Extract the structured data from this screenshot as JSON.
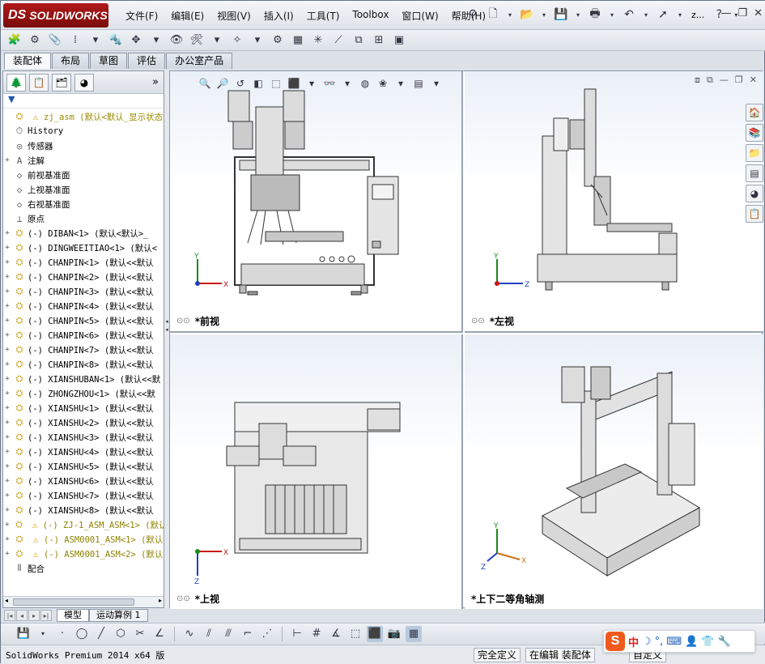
{
  "app": {
    "brand": "SOLIDWORKS",
    "brand_prefix": "DS"
  },
  "menu": [
    "文件(F)",
    "编辑(E)",
    "视图(V)",
    "插入(I)",
    "工具(T)",
    "Toolbox",
    "窗口(W)",
    "帮助(H)"
  ],
  "title_short": "z...",
  "help_label": "?",
  "cm_tabs": [
    "装配体",
    "布局",
    "草图",
    "评估",
    "办公室产品"
  ],
  "cm_active": 0,
  "fm_expand": "»",
  "filter_label": "▼",
  "tree": [
    {
      "label": "zj_asm  (默认<默认_显示状态",
      "icon": "asm",
      "warn": true,
      "expand": "",
      "style": "root"
    },
    {
      "label": "History",
      "icon": "history",
      "expand": ""
    },
    {
      "label": "传感器",
      "icon": "sensor",
      "expand": ""
    },
    {
      "label": "注解",
      "icon": "annotation",
      "expand": "+"
    },
    {
      "label": "前视基准面",
      "icon": "plane",
      "expand": ""
    },
    {
      "label": "上视基准面",
      "icon": "plane",
      "expand": ""
    },
    {
      "label": "右视基准面",
      "icon": "plane",
      "expand": ""
    },
    {
      "label": "原点",
      "icon": "origin",
      "expand": ""
    },
    {
      "label": "(-) DIBAN<1> (默认<默认>_",
      "icon": "part",
      "expand": "+"
    },
    {
      "label": "(-) DINGWEEITIAO<1> (默认<",
      "icon": "part",
      "expand": "+"
    },
    {
      "label": "(-) CHANPIN<1> (默认<<默认",
      "icon": "part",
      "expand": "+"
    },
    {
      "label": "(-) CHANPIN<2> (默认<<默认",
      "icon": "part",
      "expand": "+"
    },
    {
      "label": "(-) CHANPIN<3> (默认<<默认",
      "icon": "part",
      "expand": "+"
    },
    {
      "label": "(-) CHANPIN<4> (默认<<默认",
      "icon": "part",
      "expand": "+"
    },
    {
      "label": "(-) CHANPIN<5> (默认<<默认",
      "icon": "part",
      "expand": "+"
    },
    {
      "label": "(-) CHANPIN<6> (默认<<默认",
      "icon": "part",
      "expand": "+"
    },
    {
      "label": "(-) CHANPIN<7> (默认<<默认",
      "icon": "part",
      "expand": "+"
    },
    {
      "label": "(-) CHANPIN<8> (默认<<默认",
      "icon": "part",
      "expand": "+"
    },
    {
      "label": "(-) XIANSHUBAN<1> (默认<<默",
      "icon": "part",
      "expand": "+"
    },
    {
      "label": "(-) ZHONGZHOU<1> (默认<<默",
      "icon": "part",
      "expand": "+"
    },
    {
      "label": "(-) XIANSHU<1> (默认<<默认",
      "icon": "part",
      "expand": "+"
    },
    {
      "label": "(-) XIANSHU<2> (默认<<默认",
      "icon": "part",
      "expand": "+"
    },
    {
      "label": "(-) XIANSHU<3> (默认<<默认",
      "icon": "part",
      "expand": "+"
    },
    {
      "label": "(-) XIANSHU<4> (默认<<默认",
      "icon": "part",
      "expand": "+"
    },
    {
      "label": "(-) XIANSHU<5> (默认<<默认",
      "icon": "part",
      "expand": "+"
    },
    {
      "label": "(-) XIANSHU<6> (默认<<默认",
      "icon": "part",
      "expand": "+"
    },
    {
      "label": "(-) XIANSHU<7> (默认<<默认",
      "icon": "part",
      "expand": "+"
    },
    {
      "label": "(-) XIANSHU<8> (默认<<默认",
      "icon": "part",
      "expand": "+"
    },
    {
      "label": "(-) ZJ-1_ASM_ASM<1> (默认",
      "icon": "asm",
      "warn": true,
      "expand": "+",
      "style": "yellow"
    },
    {
      "label": "(-) ASM0001_ASM<1> (默认",
      "icon": "asm",
      "warn": true,
      "expand": "+",
      "style": "yellow"
    },
    {
      "label": "(-) ASM0001_ASM<2> (默认",
      "icon": "asm",
      "warn": true,
      "expand": "+",
      "style": "yellow"
    },
    {
      "label": "配合",
      "icon": "mates",
      "expand": ""
    }
  ],
  "bottom_tabs": [
    "模型",
    "运动算例 1"
  ],
  "viewports": [
    {
      "label": "*前视",
      "axes": [
        "Y",
        "X"
      ]
    },
    {
      "label": "*左视",
      "axes": [
        "Y",
        "Z"
      ]
    },
    {
      "label": "*上视",
      "axes": [
        "X",
        "Z"
      ]
    },
    {
      "label": "*上下二等角轴测",
      "axes": [
        "Y",
        "X",
        "Z"
      ]
    }
  ],
  "status": {
    "product": "SolidWorks Premium 2014 x64 版",
    "constraint": "完全定义",
    "editing": "在编辑 装配体",
    "custom": "自定义"
  },
  "ime": {
    "brand": "S",
    "lang": "中"
  },
  "colors": {
    "brand_red": "#a01414",
    "accent_blue": "#1f5fbf",
    "warn_yellow": "#d7a000"
  }
}
